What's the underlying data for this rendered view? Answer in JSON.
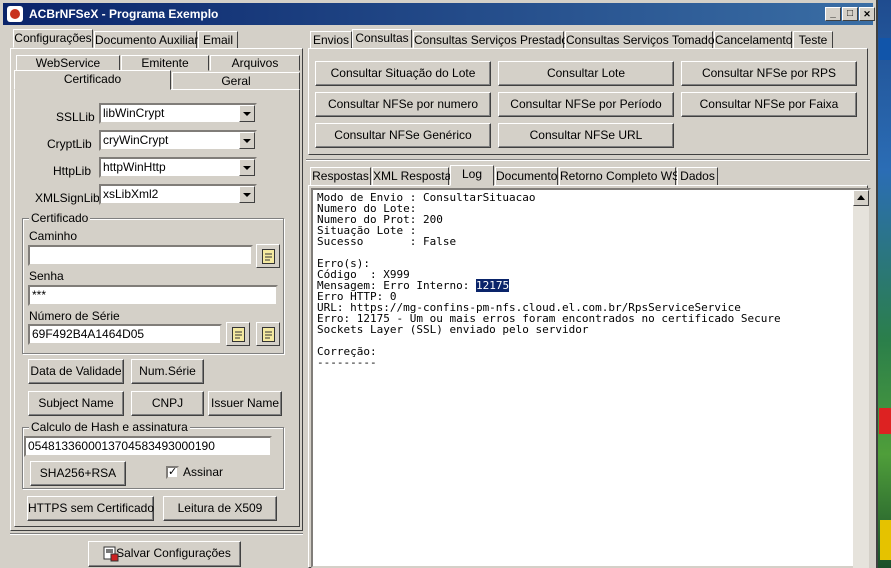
{
  "window": {
    "title": "ACBrNFSeX - Programa Exemplo",
    "min": "_",
    "max": "□",
    "close": "✕"
  },
  "left_tabs": [
    "Configurações",
    "Documento Auxiliar",
    "Email"
  ],
  "config_tabs_row1": [
    "WebService",
    "Emitente",
    "Arquivos"
  ],
  "config_tabs_row2": [
    "Certificado",
    "Geral"
  ],
  "libs": {
    "ssl_label": "SSLLib",
    "ssl_value": "libWinCrypt",
    "crypt_label": "CryptLib",
    "crypt_value": "cryWinCrypt",
    "http_label": "HttpLib",
    "http_value": "httpWinHttp",
    "xml_label": "XMLSignLib",
    "xml_value": "xsLibXml2"
  },
  "certificado": {
    "group_title": "Certificado",
    "caminho_label": "Caminho",
    "caminho_value": "",
    "senha_label": "Senha",
    "senha_value": "***",
    "serie_label": "Número de Série",
    "serie_value": "69F492B4A1464D05"
  },
  "cert_buttons": [
    "Data de Validade",
    "Num.Série",
    "Subject Name",
    "CNPJ",
    "Issuer Name"
  ],
  "hash": {
    "group_title": "Calculo de Hash e assinatura",
    "value": "05481336000137045834930001 90",
    "value_text": "0548133600013704583493000190",
    "button": "SHA256+RSA",
    "assinar_label": "Assinar",
    "assinar_checked": "✓"
  },
  "bottom_buttons": [
    "HTTPS sem Certificado",
    "Leitura de X509"
  ],
  "save_button": "Salvar Configurações",
  "right_tabs": [
    "Envios",
    "Consultas",
    "Consultas Serviços Prestados",
    "Consultas Serviços Tomados",
    "Cancelamento",
    "Teste"
  ],
  "consulta_buttons": [
    "Consultar Situação do Lote",
    "Consultar Lote",
    "Consultar NFSe por RPS",
    "Consultar NFSe por numero",
    "Consultar NFSe por Período",
    "Consultar NFSe por Faixa",
    "Consultar NFSe Genérico",
    "Consultar NFSe URL"
  ],
  "result_tabs": [
    "Respostas",
    "XML Resposta",
    "Log",
    "Documento",
    "Retorno Completo WS",
    "Dados"
  ],
  "log": {
    "lines": [
      "Modo de Envio : ConsultarSituacao",
      "Numero do Lote:",
      "Numero do Prot: 200",
      "Situação Lote :",
      "Sucesso       : False",
      "",
      "Erro(s):",
      "Código  : X999",
      "Mensagem: Erro Interno: ",
      "Erro HTTP: 0",
      "URL: https://mg-confins-pm-nfs.cloud.el.com.br/RpsServiceService",
      "Erro: 12175 - Um ou mais erros foram encontrados no certificado Secure",
      "Sockets Layer (SSL) enviado pelo servidor",
      "",
      "Correção:",
      "---------"
    ],
    "highlight": "12175"
  }
}
